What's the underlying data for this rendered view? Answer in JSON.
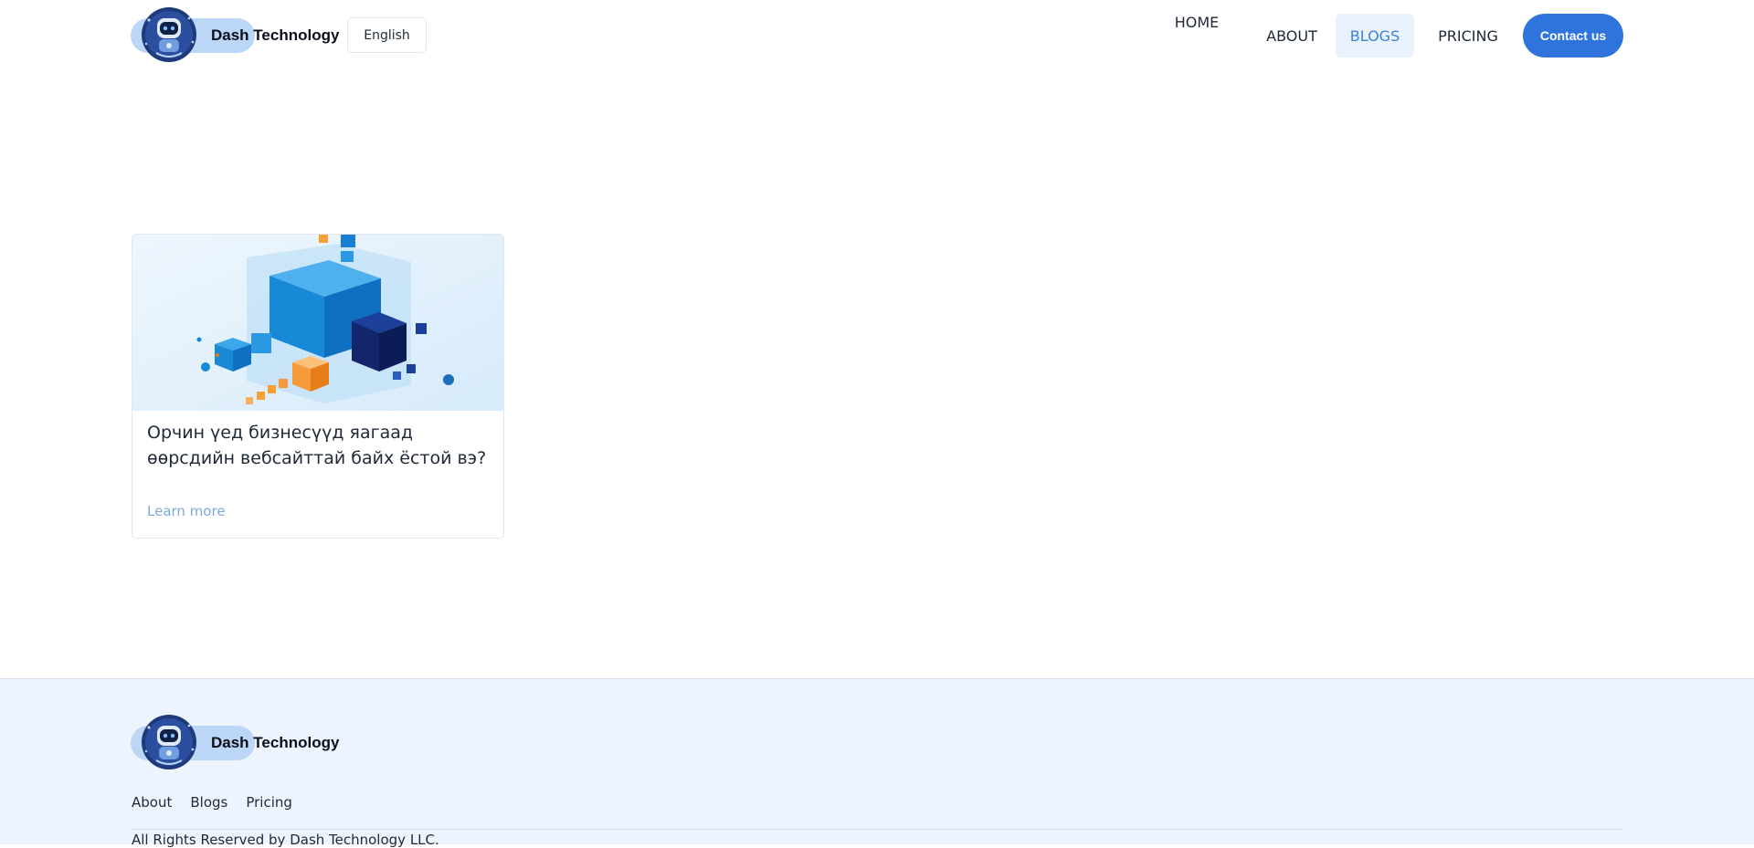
{
  "header": {
    "brand_name": "Dash Technology",
    "language": "English",
    "nav": [
      {
        "label": "HOME",
        "active": false
      },
      {
        "label": "ABOUT",
        "active": false
      },
      {
        "label": "BLOGS",
        "active": true
      },
      {
        "label": "PRICING",
        "active": false
      }
    ],
    "contact_label": "Contact us"
  },
  "blogs": [
    {
      "title": "Орчин үед бизнесүүд яагаад өөрсдийн вебсайттай байх ёстой вэ?",
      "link_label": "Learn more"
    }
  ],
  "footer": {
    "brand_name": "Dash Technology",
    "links": [
      "About",
      "Blogs",
      "Pricing"
    ],
    "copyright": "All Rights Reserved by Dash Technology LLC."
  },
  "colors": {
    "accent": "#2f74dc",
    "active_nav_bg": "#eaf3fd",
    "active_nav_text": "#3b82d6",
    "footer_bg": "#edf4fd",
    "link": "#7fa9dd"
  }
}
